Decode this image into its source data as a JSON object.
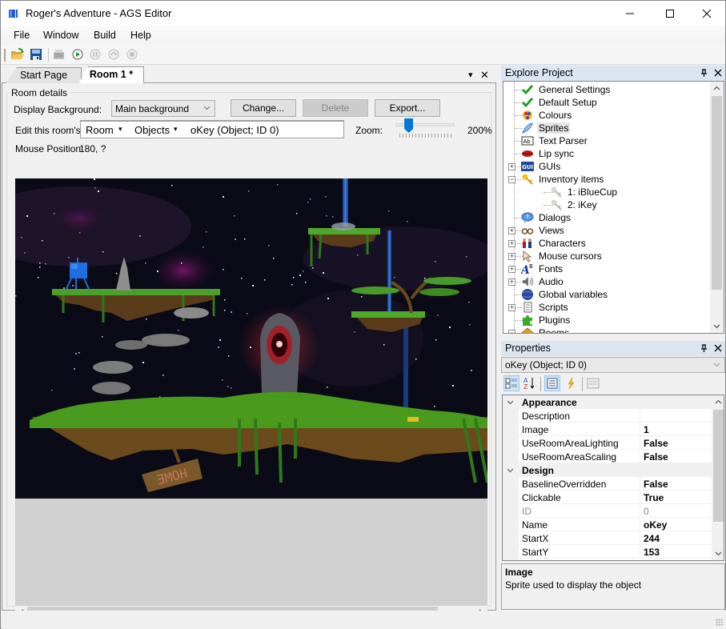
{
  "window": {
    "title": "Roger's Adventure - AGS Editor",
    "minimize_glyph": "—",
    "maximize_glyph": "☐",
    "close_glyph": "✕"
  },
  "menu": {
    "items": [
      {
        "label": "File"
      },
      {
        "label": "Window"
      },
      {
        "label": "Build"
      },
      {
        "label": "Help"
      }
    ]
  },
  "toolbar": {
    "buttons": [
      {
        "name": "open-project-icon"
      },
      {
        "name": "save-icon"
      },
      {
        "name": "build-exe-icon"
      },
      {
        "name": "run-icon"
      },
      {
        "name": "pause-icon"
      },
      {
        "name": "step-icon"
      },
      {
        "name": "stop-icon"
      }
    ]
  },
  "document": {
    "tabs": [
      {
        "label": "Start Page",
        "active": false
      },
      {
        "label": "Room 1 *",
        "active": true
      }
    ],
    "menu_glyph": "▾",
    "close_glyph": "✕"
  },
  "room": {
    "group_label": "Room details",
    "display_background_label": "Display Background:",
    "display_background_value": "Main background",
    "change_button": "Change...",
    "delete_button": "Delete",
    "export_button": "Export...",
    "edit_label": "Edit this room's:",
    "edit_breadcrumb": {
      "level1": "Room",
      "level2": "Objects",
      "level3": "oKey (Object; ID 0)"
    },
    "zoom_label": "Zoom:",
    "zoom_value": "200%",
    "zoom_slider_fraction": 0.13,
    "mouse_position_label": "Mouse Position:",
    "mouse_position_value": "180, ?",
    "sign_text": "HOME"
  },
  "explore_project": {
    "title": "Explore Project",
    "pin_glyph": "📌",
    "close_glyph": "✕",
    "items": [
      {
        "label": "General Settings",
        "icon": "checkmark-icon",
        "expander": ""
      },
      {
        "label": "Default Setup",
        "icon": "checkmark-icon",
        "expander": ""
      },
      {
        "label": "Colours",
        "icon": "palette-icon",
        "expander": ""
      },
      {
        "label": "Sprites",
        "icon": "sprite-icon",
        "expander": "",
        "selected": true
      },
      {
        "label": "Text Parser",
        "icon": "text-parser-icon",
        "expander": ""
      },
      {
        "label": "Lip sync",
        "icon": "lips-icon",
        "expander": ""
      },
      {
        "label": "GUIs",
        "icon": "gui-icon",
        "expander": "+"
      },
      {
        "label": "Inventory items",
        "icon": "keys-icon",
        "expander": "−"
      },
      {
        "label": "1: iBlueCup",
        "icon": "inventory-item-icon",
        "expander": "",
        "child": true
      },
      {
        "label": "2: iKey",
        "icon": "inventory-item-icon",
        "expander": "",
        "child": true
      },
      {
        "label": "Dialogs",
        "icon": "speech-bubble-icon",
        "expander": ""
      },
      {
        "label": "Views",
        "icon": "glasses-icon",
        "expander": "+"
      },
      {
        "label": "Characters",
        "icon": "characters-icon",
        "expander": "+"
      },
      {
        "label": "Mouse cursors",
        "icon": "cursor-icon",
        "expander": "+"
      },
      {
        "label": "Fonts",
        "icon": "font-icon",
        "expander": "+"
      },
      {
        "label": "Audio",
        "icon": "speaker-icon",
        "expander": "+"
      },
      {
        "label": "Global variables",
        "icon": "globe-icon",
        "expander": ""
      },
      {
        "label": "Scripts",
        "icon": "script-icon",
        "expander": "+"
      },
      {
        "label": "Plugins",
        "icon": "puzzle-icon",
        "expander": ""
      },
      {
        "label": "Rooms",
        "icon": "house-icon",
        "expander": "−"
      }
    ]
  },
  "properties": {
    "title": "Properties",
    "pin_glyph": "📌",
    "close_glyph": "✕",
    "selected_object": "oKey (Object; ID 0)",
    "categories": [
      {
        "name": "Appearance",
        "rows": [
          {
            "name": "Description",
            "value": ""
          },
          {
            "name": "Image",
            "value": "1"
          },
          {
            "name": "UseRoomAreaLighting",
            "value": "False"
          },
          {
            "name": "UseRoomAreaScaling",
            "value": "False"
          }
        ]
      },
      {
        "name": "Design",
        "rows": [
          {
            "name": "BaselineOverridden",
            "value": "False"
          },
          {
            "name": "Clickable",
            "value": "True"
          },
          {
            "name": "ID",
            "value": "0",
            "readonly": true
          },
          {
            "name": "Name",
            "value": "oKey"
          },
          {
            "name": "StartX",
            "value": "244"
          },
          {
            "name": "StartY",
            "value": "153"
          }
        ]
      }
    ],
    "description_title": "Image",
    "description_text": "Sprite used to display the object"
  },
  "colors": {
    "accent": "#0078d7",
    "panel_title_bg": "#dbe5f0",
    "sky": "#0a0a16",
    "grass": "#4a9a1e",
    "dirt": "#6b4a1c",
    "waterfall": "#2a66c8"
  }
}
